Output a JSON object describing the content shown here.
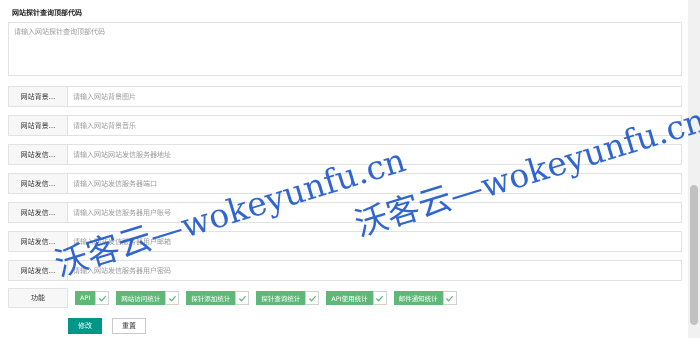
{
  "header": {
    "title": "网站探针查询顶部代码",
    "textarea_placeholder": "请输入网站探针查询顶部代码"
  },
  "rows": [
    {
      "label": "网站背景...",
      "placeholder": "请输入网站背景图片"
    },
    {
      "label": "网站背景...",
      "placeholder": "请输入网站背景音乐"
    },
    {
      "label": "网站发信...",
      "placeholder": "请输入网站网站发信服务器地址"
    },
    {
      "label": "网站发信...",
      "placeholder": "请输入网站发信服务器端口"
    },
    {
      "label": "网站发信...",
      "placeholder": "请输入网站发信服务器用户账号"
    },
    {
      "label": "网站发信...",
      "placeholder": "请输入网站发信服务器用户邮箱"
    },
    {
      "label": "网站发信...",
      "placeholder": "请输入网站发信服务器用户密码"
    }
  ],
  "functions": {
    "label": "功能",
    "items": [
      {
        "label": "API",
        "checked": true
      },
      {
        "label": "网站访问统计",
        "checked": true
      },
      {
        "label": "探针添加统计",
        "checked": true
      },
      {
        "label": "探针查询统计",
        "checked": true
      },
      {
        "label": "API使用统计",
        "checked": true
      },
      {
        "label": "邮件通知统计",
        "checked": true
      }
    ]
  },
  "buttons": {
    "submit": "修改",
    "reset": "重置"
  },
  "watermark": "沃客云—wokeyunfu.cn",
  "colors": {
    "primary": "#009688",
    "checkbox_green": "#5fb878",
    "watermark_blue": "#1a56c9"
  }
}
